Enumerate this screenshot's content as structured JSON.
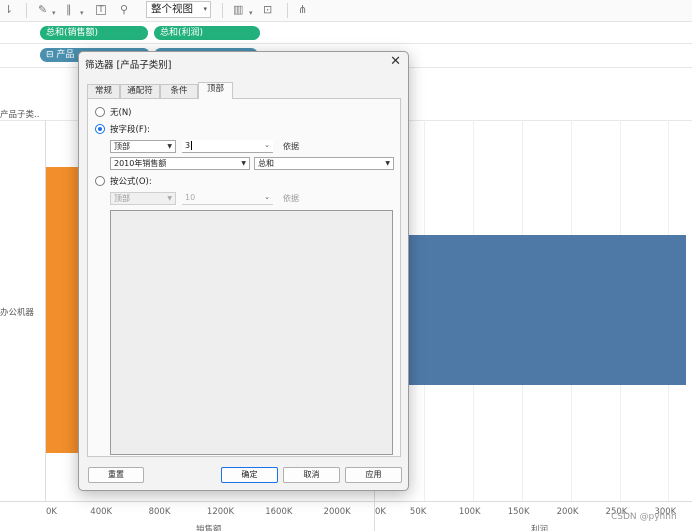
{
  "toolbar": {
    "view_select": "整个视图",
    "icons": [
      "sort-icon",
      "pen-icon",
      "clip-icon",
      "text-icon",
      "pin-icon",
      "chart-icon",
      "presentation-icon",
      "share-icon"
    ]
  },
  "shelves": {
    "columns_pills": [
      "总和(销售额)",
      "总和(利润)"
    ],
    "rows_pill": "产品"
  },
  "view": {
    "header_label": "产品子类..",
    "row_label": "办公机器",
    "sales_axis": {
      "ticks": [
        "0K",
        "400K",
        "800K",
        "1200K",
        "1600K",
        "2000K"
      ],
      "title": "销售额"
    },
    "profit_axis": {
      "ticks": [
        "0K",
        "50K",
        "100K",
        "150K",
        "200K",
        "250K",
        "300K"
      ],
      "title": "利润"
    },
    "watermark": "CSDN @pyhhh"
  },
  "chart_data": [
    {
      "type": "bar",
      "orientation": "horizontal",
      "categories": [
        "办公机器"
      ],
      "series": [
        {
          "values": [
            2100000
          ]
        }
      ],
      "xlabel": "销售额",
      "xlim": [
        0,
        2250000
      ],
      "color": "#f28e2b"
    },
    {
      "type": "bar",
      "orientation": "horizontal",
      "categories": [
        "办公机器"
      ],
      "series": [
        {
          "values": [
            318000
          ]
        }
      ],
      "xlabel": "利润",
      "xlim": [
        0,
        320000
      ],
      "color": "#4e79a7"
    }
  ],
  "dialog": {
    "title": "筛选器 [产品子类别]",
    "tabs": [
      "常规",
      "通配符",
      "条件",
      "顶部"
    ],
    "active_tab": "顶部",
    "options": {
      "none_label": "无(N)",
      "by_field_label": "按字段(F):",
      "by_formula_label": "按公式(O):"
    },
    "by_field": {
      "direction": "顶部",
      "count": "3",
      "basis_label": "依据",
      "field": "2010年销售额",
      "aggregation": "总和"
    },
    "by_formula": {
      "direction": "顶部",
      "count": "10",
      "basis_label": "依据"
    },
    "buttons": {
      "reset": "重置",
      "ok": "确定",
      "cancel": "取消",
      "apply": "应用"
    }
  }
}
